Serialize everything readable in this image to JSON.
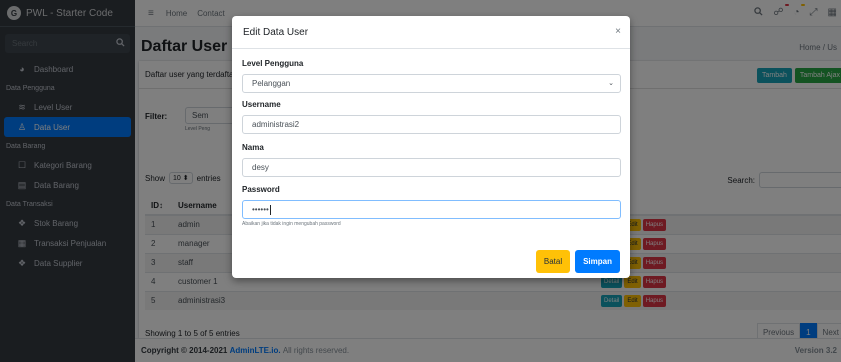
{
  "brand": {
    "logo_letter": "G",
    "name": "PWL - Starter Code"
  },
  "sidebar": {
    "search_placeholder": "Search",
    "sections": [
      {
        "header": "",
        "items": [
          {
            "label": "Dashboard",
            "icon": "dashboard-icon",
            "active": false
          }
        ]
      },
      {
        "header": "Data Pengguna",
        "items": [
          {
            "label": "Level User",
            "icon": "layers-icon",
            "active": false
          },
          {
            "label": "Data User",
            "icon": "user-icon",
            "active": true
          }
        ]
      },
      {
        "header": "Data Barang",
        "items": [
          {
            "label": "Kategori Barang",
            "icon": "square-icon",
            "active": false
          },
          {
            "label": "Data Barang",
            "icon": "list-icon",
            "active": false
          }
        ]
      },
      {
        "header": "Data Transaksi",
        "items": [
          {
            "label": "Stok Barang",
            "icon": "cubes-icon",
            "active": false
          },
          {
            "label": "Transaksi Penjualan",
            "icon": "cash-register-icon",
            "active": false
          },
          {
            "label": "Data Supplier",
            "icon": "cubes-icon",
            "active": false
          }
        ]
      }
    ]
  },
  "topbar": {
    "home": "Home",
    "contact": "Contact"
  },
  "page": {
    "title": "Daftar User",
    "breadcrumb": "Home / Us"
  },
  "card": {
    "header": "Daftar user yang terdafta",
    "btn_tambah": "Tambah",
    "btn_tambah_ajax": "Tambah Ajax"
  },
  "filter": {
    "label": "Filter:",
    "value": "Sem",
    "help": "Level Peng"
  },
  "table": {
    "show_prefix": "Show",
    "show_value": "10",
    "show_suffix": "entries",
    "search_label": "Search:",
    "headers": {
      "id": "ID",
      "username": "Username",
      "aksi": "Aksi"
    },
    "rows": [
      {
        "id": "1",
        "username": "admin"
      },
      {
        "id": "2",
        "username": "manager"
      },
      {
        "id": "3",
        "username": "staff"
      },
      {
        "id": "4",
        "username": "customer 1"
      },
      {
        "id": "5",
        "username": "administrasi3"
      }
    ],
    "action_detail": "Detail",
    "action_edit": "Edit",
    "action_hapus": "Hapus",
    "showing": "Showing 1 to 5 of 5 entries",
    "prev": "Previous",
    "page": "1",
    "next": "Next"
  },
  "footer": {
    "copyright": "Copyright © 2014-2021",
    "brand": "AdminLTE.io.",
    "rights": "All rights reserved.",
    "version": "Version 3.2"
  },
  "modal": {
    "title": "Edit Data User",
    "close": "×",
    "level_label": "Level Pengguna",
    "level_value": "Pelanggan",
    "username_label": "Username",
    "username_value": "administrasi2",
    "nama_label": "Nama",
    "nama_value": "desy",
    "password_label": "Password",
    "password_value": "••••••",
    "password_help": "Abaikan jika tidak ingin mengubah password",
    "btn_batal": "Batal",
    "btn_simpan": "Simpan"
  }
}
